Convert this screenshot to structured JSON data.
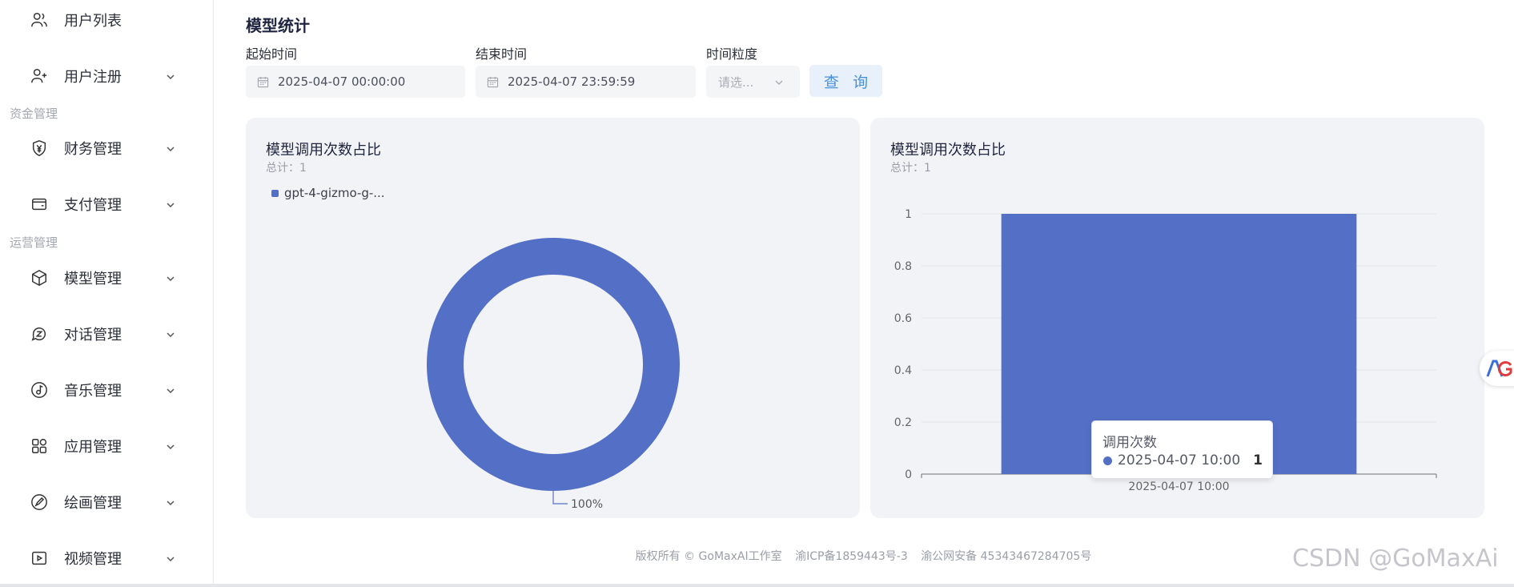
{
  "sidebar": {
    "items": [
      {
        "label": "用户列表",
        "icon": "users-icon",
        "chevron": false
      },
      {
        "label": "用户注册",
        "icon": "user-add-icon",
        "chevron": true
      },
      {
        "label": "财务管理",
        "icon": "yen-shield-icon",
        "chevron": true
      },
      {
        "label": "支付管理",
        "icon": "wallet-icon",
        "chevron": true
      },
      {
        "label": "模型管理",
        "icon": "cube-icon",
        "chevron": true
      },
      {
        "label": "对话管理",
        "icon": "dialog-icon",
        "chevron": true
      },
      {
        "label": "音乐管理",
        "icon": "music-icon",
        "chevron": true
      },
      {
        "label": "应用管理",
        "icon": "apps-icon",
        "chevron": true
      },
      {
        "label": "绘画管理",
        "icon": "paint-icon",
        "chevron": true
      },
      {
        "label": "视频管理",
        "icon": "video-icon",
        "chevron": true
      }
    ],
    "groups": [
      "资金管理",
      "运营管理"
    ]
  },
  "page": {
    "title": "模型统计"
  },
  "filters": {
    "start_label": "起始时间",
    "start_value": "2025-04-07 00:00:00",
    "end_label": "结束时间",
    "end_value": "2025-04-07 23:59:59",
    "granularity_label": "时间粒度",
    "granularity_placeholder": "请选...",
    "query_label": "查 询"
  },
  "pie_card": {
    "title": "模型调用次数占比",
    "total": "总计：1",
    "legend": "gpt-4-gizmo-g-...",
    "slice_label": "100%"
  },
  "bar_card": {
    "title": "模型调用次数占比",
    "total": "总计：1"
  },
  "tooltip": {
    "title": "调用次数",
    "name": "2025-04-07 10:00",
    "value": "1"
  },
  "footer": {
    "copyright": "版权所有 © GoMaxAI工作室",
    "icp": "渝ICP备1859443号-3",
    "police": "渝公网安备 45343467284705号"
  },
  "watermark": "CSDN @GoMaxAi",
  "colors": {
    "accent": "#5470c6",
    "query_bg": "#e8f1fb",
    "query_text": "#4a90d9",
    "card_bg": "#f2f3f6"
  },
  "chart_data": [
    {
      "type": "pie",
      "donut": true,
      "title": "模型调用次数占比",
      "subtitle": "总计：1",
      "slices": [
        {
          "name": "gpt-4-gizmo-g-...",
          "value": 1,
          "label": "100%"
        }
      ],
      "legend": "top-left"
    },
    {
      "type": "bar",
      "title": "模型调用次数占比",
      "subtitle": "总计：1",
      "categories": [
        "2025-04-07 10:00"
      ],
      "series": [
        {
          "name": "调用次数",
          "values": [
            1
          ]
        }
      ],
      "yticks": [
        "0",
        "0.2",
        "0.4",
        "0.6",
        "0.8",
        "1"
      ],
      "ylim": [
        0,
        1
      ],
      "grid": true
    }
  ]
}
